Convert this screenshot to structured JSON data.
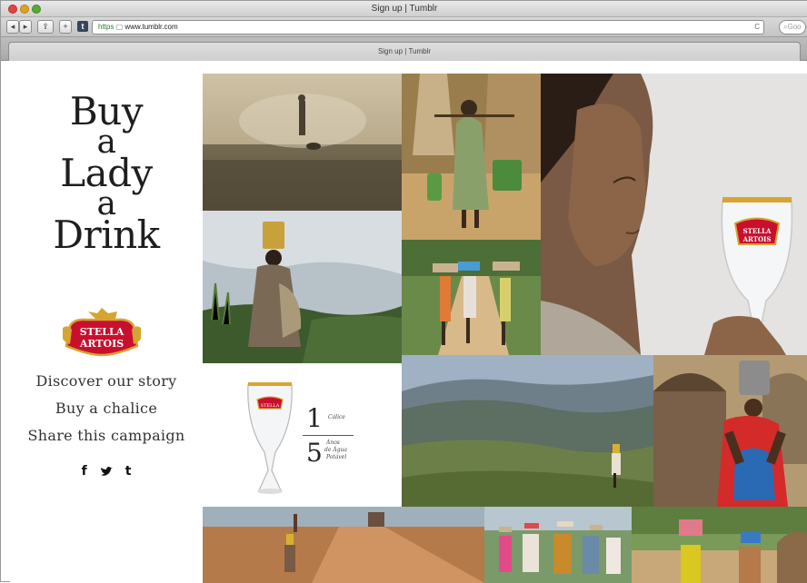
{
  "browser": {
    "window_title": "Sign up | Tumblr",
    "url_scheme": "https",
    "url": "www.tumblr.com",
    "tab_title": "Sign up | Tumblr",
    "search_placeholder": "Goo"
  },
  "campaign": {
    "headline": [
      "Buy",
      "a",
      "Lady",
      "a",
      "Drink"
    ],
    "brand_line1": "STELLA",
    "brand_line2": "ARTOIS",
    "menu": [
      "Discover our story",
      "Buy a chalice",
      "Share this campaign"
    ],
    "social": [
      "f",
      "t"
    ]
  },
  "chalice_panel": {
    "glass_text": "STELLA",
    "top_number": "1",
    "top_label": "Cálice",
    "bottom_number": "5",
    "bottom_label_1": "Anos",
    "bottom_label_2": "de Água",
    "bottom_label_3": "Potável"
  },
  "photos": {
    "woman_glass_text1": "STELLA",
    "woman_glass_text2": "ARTOIS"
  },
  "colors": {
    "stella_red": "#c8102e",
    "stella_gold": "#d6a531"
  }
}
